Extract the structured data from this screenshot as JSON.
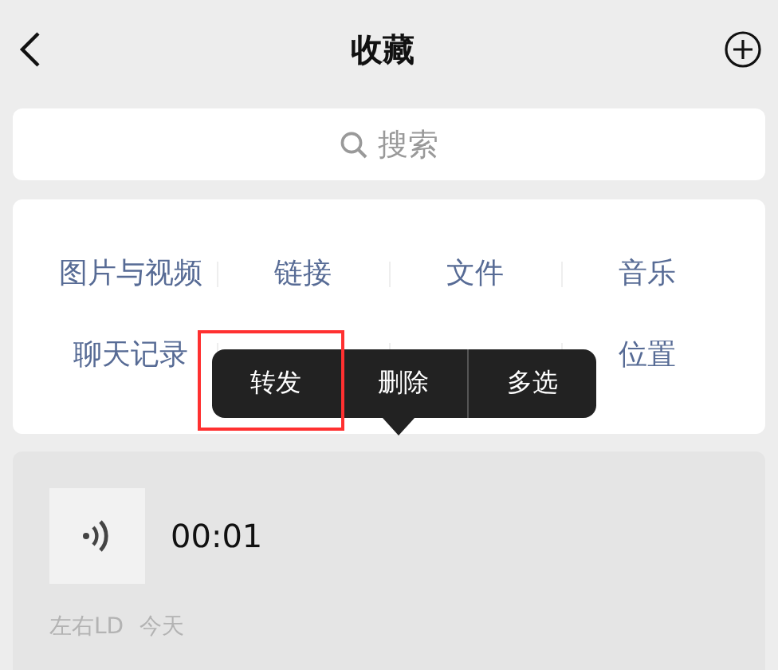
{
  "header": {
    "title": "收藏"
  },
  "search": {
    "placeholder": "搜索"
  },
  "categories": [
    [
      {
        "kind": "label",
        "label": "图片与视频"
      },
      {
        "kind": "label",
        "label": "链接"
      },
      {
        "kind": "label",
        "label": "文件"
      },
      {
        "kind": "label",
        "label": "音乐"
      }
    ],
    [
      {
        "kind": "label",
        "label": "聊天记录"
      },
      {
        "kind": "hidden"
      },
      {
        "kind": "hidden"
      },
      {
        "kind": "label",
        "label": "位置"
      }
    ]
  ],
  "context_menu": [
    {
      "label": "转发",
      "highlighted": true
    },
    {
      "label": "删除",
      "highlighted": false
    },
    {
      "label": "多选",
      "highlighted": false
    }
  ],
  "items": [
    {
      "kind": "voice",
      "duration": "00:01",
      "source": "左右LD",
      "time": "今天"
    }
  ]
}
